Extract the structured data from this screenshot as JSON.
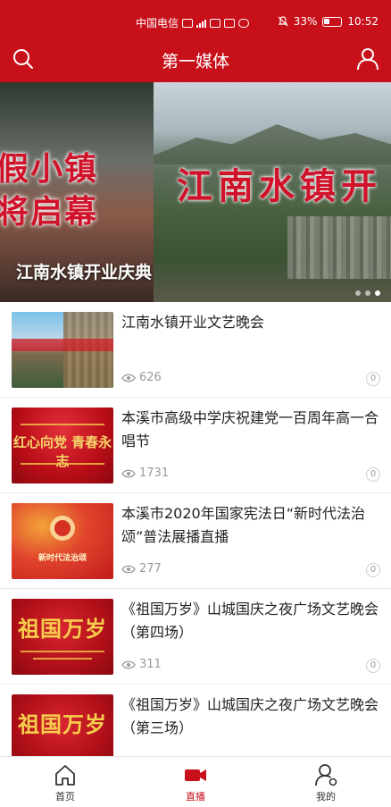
{
  "status_bar": {
    "carrier": "中国电信",
    "battery": "33%",
    "time": "10:52"
  },
  "header": {
    "title": "第一媒体"
  },
  "banner": {
    "left_image_text_1": "假小镇",
    "left_image_text_2": "将启幕",
    "right_image_text": "江南水镇开",
    "caption": "江南水镇开业庆典",
    "slide_count": 3,
    "active_slide": 3
  },
  "articles": [
    {
      "title": "江南水镇开业文艺晚会",
      "views": "626",
      "comments": "0",
      "thumb_text": ""
    },
    {
      "title": "本溪市高级中学庆祝建党一百周年高一合唱节",
      "views": "1731",
      "comments": "0",
      "thumb_text": "红心向党 青春永志"
    },
    {
      "title": "本溪市2020年国家宪法日“新时代法治颂”普法展播直播",
      "views": "277",
      "comments": "0",
      "thumb_text": "新时代法治颂"
    },
    {
      "title": "《祖国万岁》山城国庆之夜广场文艺晚会（第四场）",
      "views": "311",
      "comments": "0",
      "thumb_text": "祖国万岁"
    },
    {
      "title": "《祖国万岁》山城国庆之夜广场文艺晚会（第三场）",
      "views": "",
      "comments": "",
      "thumb_text": "祖国万岁"
    }
  ],
  "tabbar": {
    "home": "首页",
    "live": "直播",
    "mine": "我的"
  },
  "colors": {
    "brand": "#c8101b",
    "muted": "#9a9a9a"
  }
}
